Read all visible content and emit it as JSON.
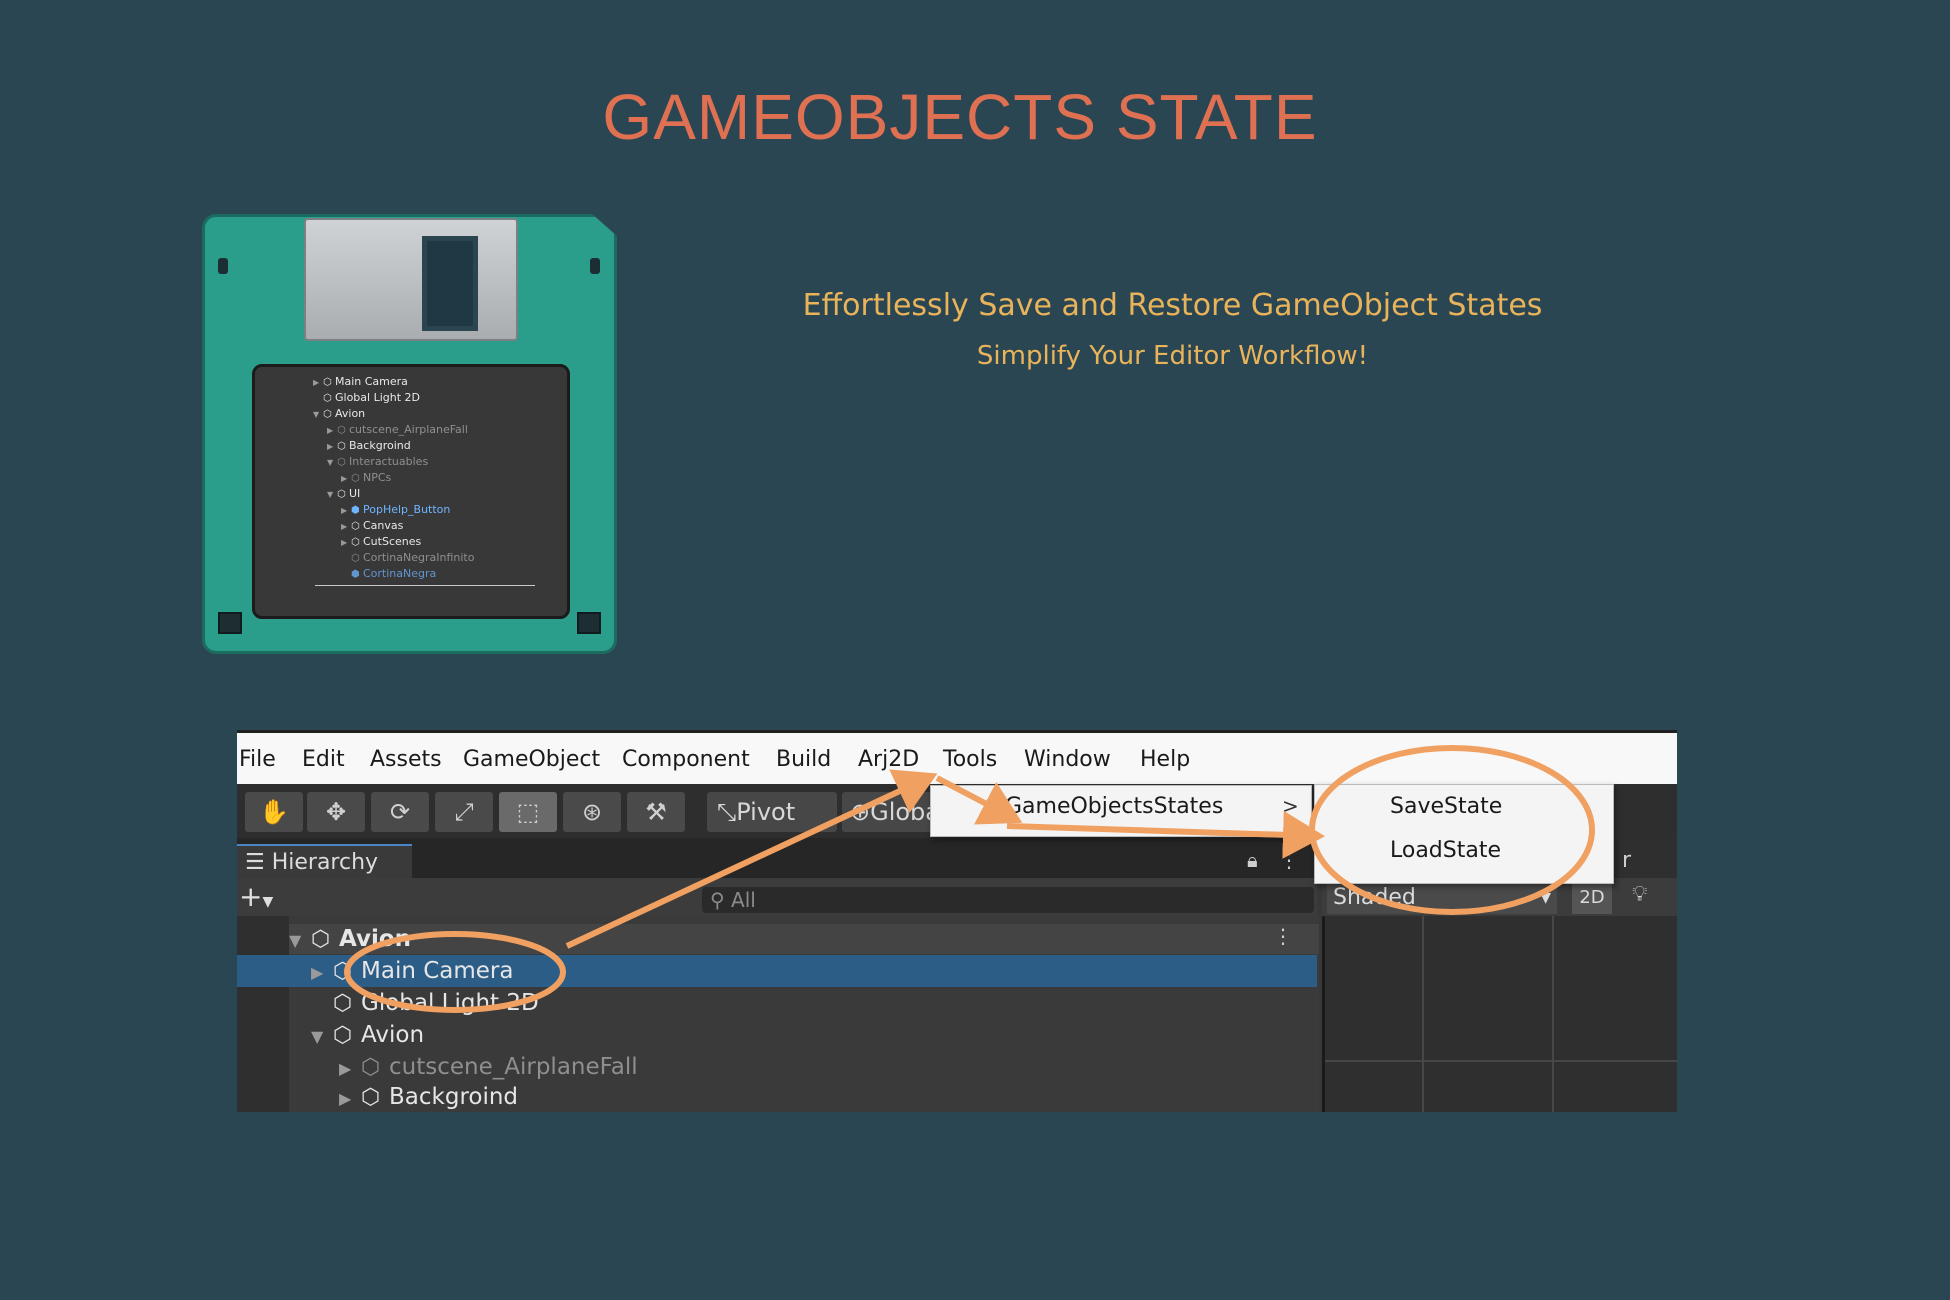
{
  "title": "GAMEOBJECTS STATE",
  "tagline": {
    "line1": "Effortlessly Save and Restore GameObject States",
    "line2": "Simplify Your Editor Workflow!"
  },
  "floppy_hierarchy": [
    {
      "label": "Main Camera",
      "state": "normal"
    },
    {
      "label": "Global Light 2D",
      "state": "normal"
    },
    {
      "label": "Avion",
      "state": "normal"
    },
    {
      "label": "cutscene_AirplaneFall",
      "state": "dim"
    },
    {
      "label": "Backgroind",
      "state": "normal"
    },
    {
      "label": "Interactuables",
      "state": "dim"
    },
    {
      "label": "NPCs",
      "state": "dim"
    },
    {
      "label": "UI",
      "state": "normal"
    },
    {
      "label": "PopHelp_Button",
      "state": "blue"
    },
    {
      "label": "Canvas",
      "state": "normal"
    },
    {
      "label": "CutScenes",
      "state": "normal"
    },
    {
      "label": "CortinaNegraInfinito",
      "state": "dim"
    },
    {
      "label": "CortinaNegra",
      "state": "blue"
    }
  ],
  "menubar": [
    "File",
    "Edit",
    "Assets",
    "GameObject",
    "Component",
    "Build",
    "Arj2D",
    "Tools",
    "Window",
    "Help"
  ],
  "toolbar": {
    "pivot": "Pivot",
    "global": "Globa"
  },
  "hierarchy": {
    "tab": "Hierarchy",
    "search_placeholder": "All",
    "rows": [
      {
        "label": "Avion",
        "state": "scene"
      },
      {
        "label": "Main Camera",
        "state": "selected"
      },
      {
        "label": "Global Light 2D",
        "state": "normal"
      },
      {
        "label": "Avion",
        "state": "normal"
      },
      {
        "label": "cutscene_AirplaneFall",
        "state": "dim"
      },
      {
        "label": "Backgroind",
        "state": "normal"
      }
    ]
  },
  "scene_view": {
    "shading": "Shaded",
    "mode_2d": "2D",
    "tab_fragment": "r"
  },
  "submenu": {
    "item": "GameObjectsStates",
    "arrow": ">"
  },
  "states_menu": {
    "save": "SaveState",
    "load": "LoadState"
  },
  "colors": {
    "background": "#2a4653",
    "title": "#e07052",
    "tagline": "#e9b35a",
    "annotation": "#f0a060",
    "selection": "#2c5d87"
  }
}
